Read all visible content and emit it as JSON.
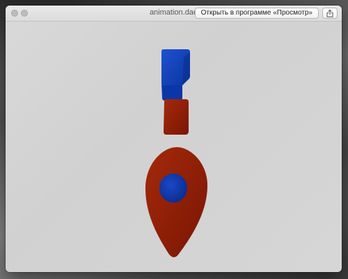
{
  "window": {
    "title": "animation.dae",
    "open_button_label": "Открыть в программе «Просмотр»"
  },
  "icons": {
    "close": "close-icon",
    "minimize": "minimize-icon",
    "share": "share-icon"
  },
  "colors": {
    "blue": "#0a3aa8",
    "red": "#8a1a05"
  }
}
